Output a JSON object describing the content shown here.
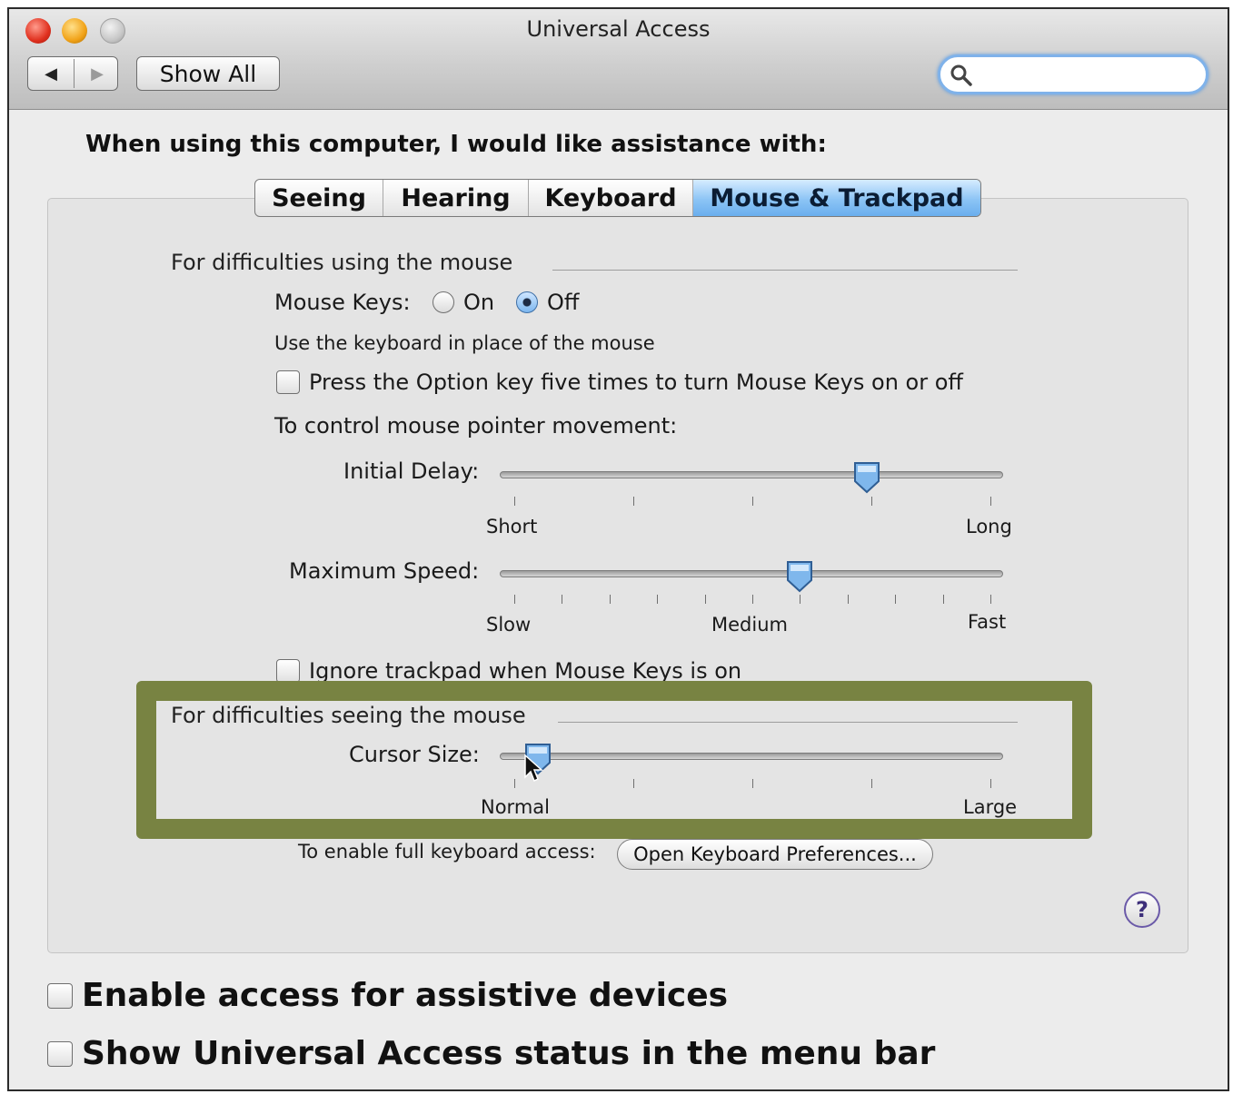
{
  "window": {
    "title": "Universal Access",
    "back_icon": "◀",
    "forward_icon": "▶",
    "show_all_label": "Show All",
    "search": {
      "placeholder": "",
      "value": ""
    }
  },
  "heading": "When using this computer, I would like assistance with:",
  "tabs": [
    {
      "label": "Seeing",
      "active": false
    },
    {
      "label": "Hearing",
      "active": false
    },
    {
      "label": "Keyboard",
      "active": false
    },
    {
      "label": "Mouse & Trackpad",
      "active": true
    }
  ],
  "mouse_section": {
    "title": "For difficulties using the mouse",
    "mouse_keys_label": "Mouse Keys:",
    "on_label": "On",
    "off_label": "Off",
    "mouse_keys_state": "Off",
    "mouse_keys_hint": "Use the keyboard in place of the mouse",
    "option_key_checkbox": {
      "label": "Press the Option key five times to turn Mouse Keys on or off",
      "checked": false
    },
    "pointer_control_label": "To control mouse pointer movement:",
    "initial_delay": {
      "label": "Initial Delay:",
      "min_label": "Short",
      "max_label": "Long",
      "value": 0.74,
      "ticks": 5
    },
    "maximum_speed": {
      "label": "Maximum Speed:",
      "min_label": "Slow",
      "mid_label": "Medium",
      "max_label": "Fast",
      "value": 0.6,
      "ticks": 11
    },
    "ignore_trackpad_checkbox": {
      "label": "Ignore trackpad when Mouse Keys is on",
      "checked": false
    }
  },
  "seeing_section": {
    "title": "For difficulties seeing the mouse",
    "cursor_size": {
      "label": "Cursor Size:",
      "min_label": "Normal",
      "max_label": "Large",
      "value": 0.05,
      "ticks": 5
    }
  },
  "keyboard_access_label": "To enable full keyboard access:",
  "open_keyboard_prefs_label": "Open Keyboard Preferences...",
  "help_label": "?",
  "assistive_devices_checkbox": {
    "label": "Enable access for assistive devices",
    "checked": false
  },
  "status_menu_checkbox": {
    "label": "Show Universal Access status in the menu bar",
    "checked": false
  },
  "colors": {
    "highlight": "#788342",
    "accent": "#69aeee"
  }
}
